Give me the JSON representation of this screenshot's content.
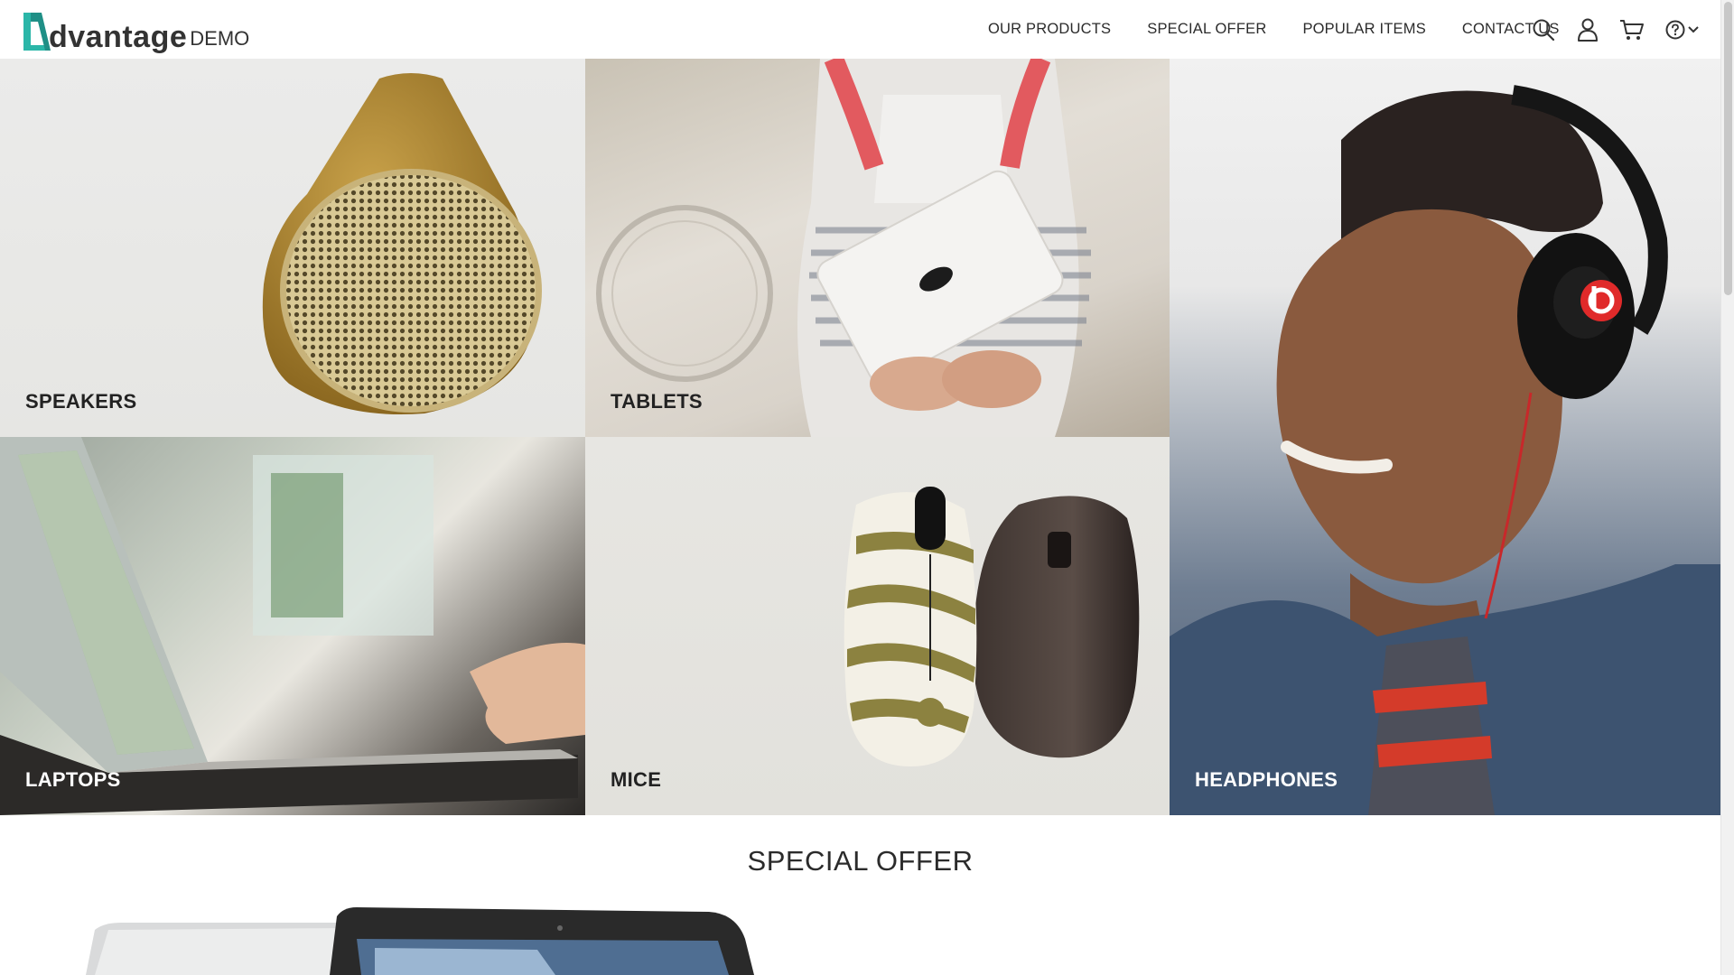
{
  "brand": {
    "name": "dvantage",
    "suffix": "DEMO",
    "accent_color": "#2bb6a8"
  },
  "nav": {
    "items": [
      {
        "label": "OUR PRODUCTS"
      },
      {
        "label": "SPECIAL OFFER"
      },
      {
        "label": "POPULAR ITEMS"
      },
      {
        "label": "CONTACT US"
      }
    ],
    "icons": [
      "search-icon",
      "user-icon",
      "cart-icon",
      "help-icon",
      "chevron-down-icon"
    ]
  },
  "categories": {
    "speakers": {
      "label": "SPEAKERS"
    },
    "tablets": {
      "label": "TABLETS"
    },
    "laptops": {
      "label": "LAPTOPS"
    },
    "mice": {
      "label": "MICE"
    },
    "headphones": {
      "label": "HEADPHONES"
    }
  },
  "special_offer": {
    "title": "SPECIAL OFFER"
  }
}
